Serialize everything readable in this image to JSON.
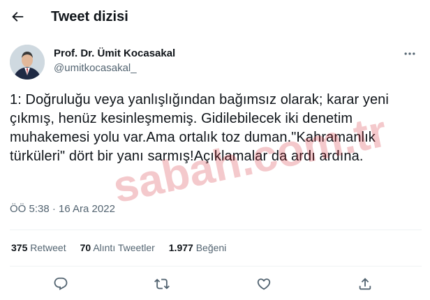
{
  "header": {
    "title": "Tweet dizisi",
    "back_icon": "arrow-left-icon"
  },
  "author": {
    "name": "Prof. Dr. Ümit Kocasakal",
    "handle": "@umitkocasakal_"
  },
  "tweet": {
    "text": "1: Doğruluğu veya yanlışlığından bağımsız olarak; karar yeni çıkmış, henüz kesinleşmemiş. Gidilebilecek iki denetim muhakemesi yolu var.Ama ortalık toz duman.\"Kahramanlık türküleri\" dört bir yanı sarmış!Açıklamalar da ardı ardına.",
    "timestamp": "ÖÖ 5:38 · 16 Ara 2022"
  },
  "stats": {
    "retweets_count": "375",
    "retweets_label": "Retweet",
    "quotes_count": "70",
    "quotes_label": "Alıntı Tweetler",
    "likes_count": "1.977",
    "likes_label": "Beğeni"
  },
  "watermark": {
    "text": "sabah.com.tr"
  },
  "colors": {
    "text": "#0f1419",
    "secondary": "#536471",
    "divider": "#eff3f4"
  }
}
